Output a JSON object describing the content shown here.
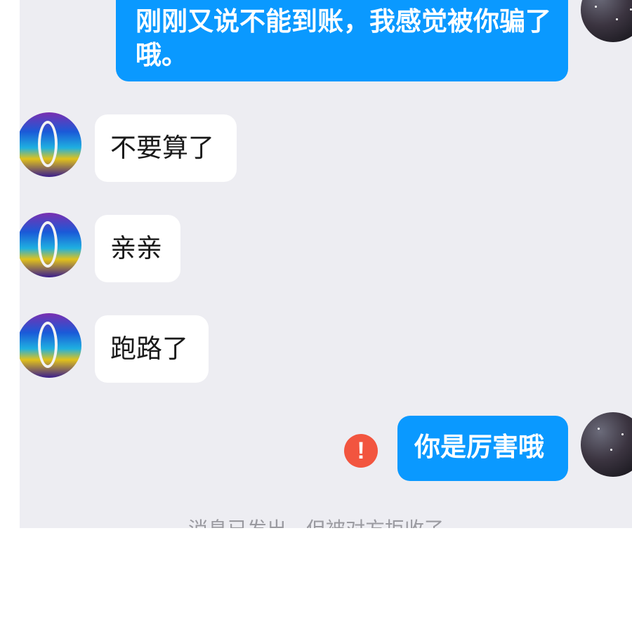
{
  "conversation": {
    "messages": [
      {
        "side": "outgoing",
        "text": "刚刚又说不能到账，我感觉被你骗了哦。",
        "status": ""
      },
      {
        "side": "incoming",
        "text": "不要算了"
      },
      {
        "side": "incoming",
        "text": "亲亲"
      },
      {
        "side": "incoming",
        "text": "跑路了"
      },
      {
        "side": "outgoing",
        "text": "你是厉害哦",
        "status": "failed"
      }
    ],
    "system_notice": "消息已发出，但被对方拒收了。",
    "icons": {
      "failed_status": "error-exclamation-icon"
    },
    "colors": {
      "outgoing_bubble": "#0a99ff",
      "incoming_bubble": "#ffffff",
      "chat_background": "#ededf2",
      "error": "#f2553f"
    }
  }
}
